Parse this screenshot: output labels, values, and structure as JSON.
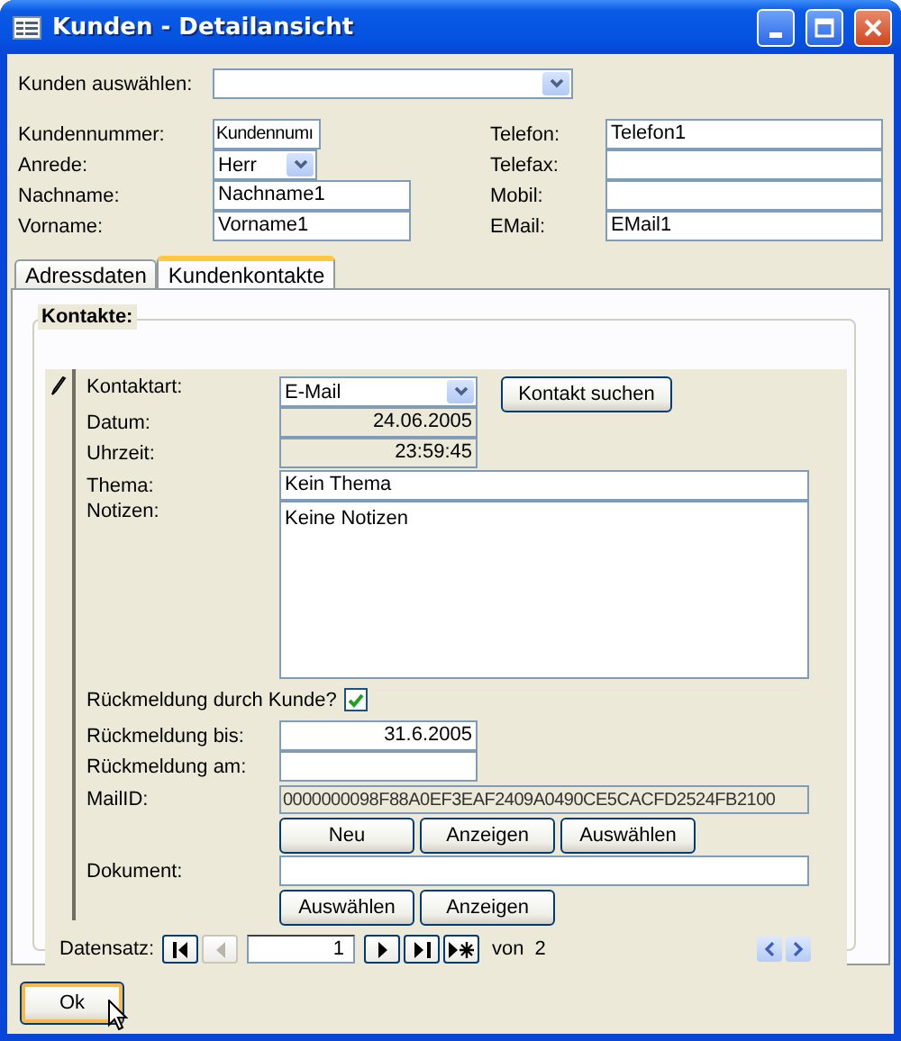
{
  "window": {
    "title": "Kunden - Detailansicht"
  },
  "customer_select": {
    "label": "Kunden auswählen:"
  },
  "customer_left": [
    {
      "kind": "code",
      "label": "Kundennummer:",
      "value": "Kundennumı"
    },
    {
      "kind": "combo",
      "label": "Anrede:",
      "value": "Herr"
    },
    {
      "kind": "text",
      "label": "Nachname:",
      "value": "Nachname1"
    },
    {
      "kind": "text",
      "label": "Vorname:",
      "value": "Vorname1"
    }
  ],
  "customer_right": [
    {
      "label": "Telefon:",
      "value": "Telefon1"
    },
    {
      "label": "Telefax:"
    },
    {
      "label": "Mobil:"
    },
    {
      "label": "EMail:",
      "value": "EMail1"
    }
  ],
  "tabs": [
    {
      "label": "Adressdaten",
      "selected": false
    },
    {
      "label": "Kundenkontakte",
      "selected": true
    }
  ],
  "contacts": {
    "title": "Kontakte:",
    "search_button": "Kontakt suchen",
    "rows": [
      {
        "kind": "combo",
        "label": "Kontaktart:",
        "value": "E-Mail"
      },
      {
        "kind": "readonly",
        "label": "Datum:",
        "value": "24.06.2005"
      },
      {
        "kind": "readonly",
        "label": "Uhrzeit:",
        "value": "23:59:45"
      },
      {
        "kind": "text",
        "label": "Thema:",
        "value": "Kein Thema"
      },
      {
        "kind": "memo",
        "label": "Notizen:",
        "value": "Keine Notizen"
      },
      {
        "kind": "checkbox",
        "label": "Rückmeldung durch Kunde?",
        "checked": true
      },
      {
        "kind": "date",
        "label": "Rückmeldung bis:",
        "value": "31.6.2005"
      },
      {
        "kind": "date",
        "label": "Rückmeldung am:"
      },
      {
        "kind": "id",
        "label": "MailID:",
        "value": "0000000098F88A0EF3EAF2409A0490CE5CACFD2524FB2100"
      },
      {
        "kind": "buttons",
        "buttons": [
          "Neu",
          "Anzeigen",
          "Auswählen"
        ]
      },
      {
        "kind": "text",
        "label": "Dokument:"
      },
      {
        "kind": "buttons",
        "buttons": [
          "Auswählen",
          "Anzeigen"
        ]
      }
    ],
    "navigation": {
      "label": "Datensatz:",
      "current": "1",
      "of": "von",
      "total": "2",
      "buttons": [
        {
          "kind": "first",
          "disabled": false
        },
        {
          "kind": "prev",
          "disabled": true
        },
        {
          "kind": "field"
        },
        {
          "kind": "next",
          "disabled": false
        },
        {
          "kind": "last",
          "disabled": false
        },
        {
          "kind": "new",
          "disabled": false
        }
      ]
    }
  },
  "ok_button": "Ok"
}
